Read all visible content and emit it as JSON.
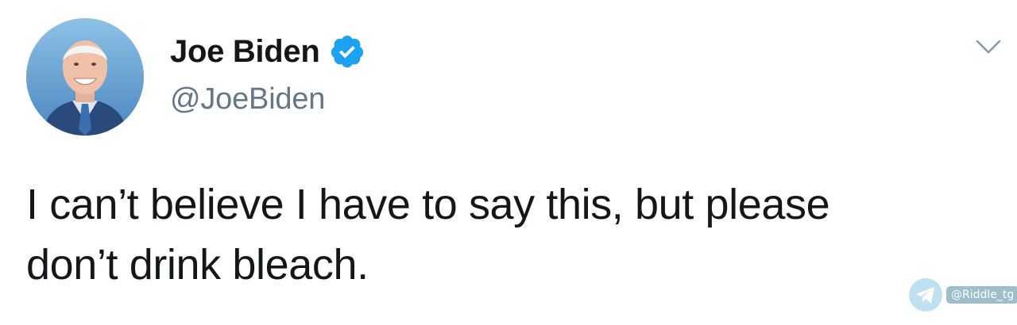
{
  "tweet": {
    "author": {
      "display_name": "Joe Biden",
      "handle": "@JoeBiden",
      "verified": true,
      "avatar_icon": "profile-photo"
    },
    "text_lines": [
      "I can’t believe I have to say this, but please",
      "don’t drink bleach."
    ],
    "menu_icon": "chevron-down-icon"
  },
  "watermark": {
    "icon": "telegram-icon",
    "label": "@Riddle_tg"
  },
  "colors": {
    "text": "#14171a",
    "handle": "#657786",
    "verified_badge": "#1da1f2",
    "chevron": "#8899a6"
  }
}
